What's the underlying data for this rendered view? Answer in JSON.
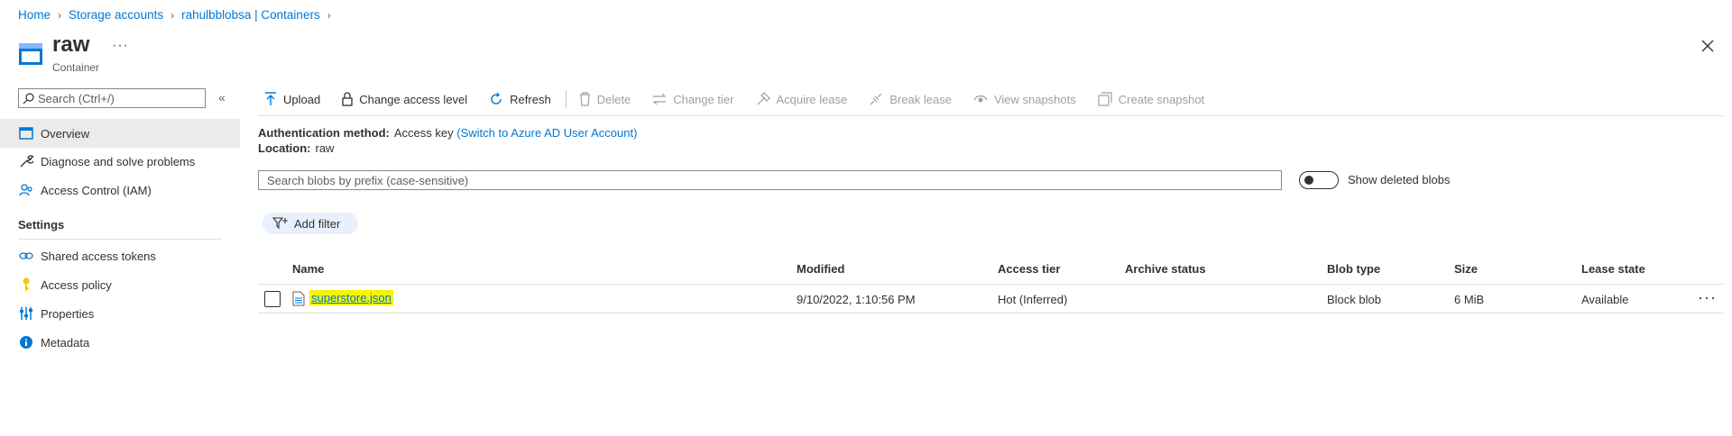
{
  "breadcrumb": [
    "Home",
    "Storage accounts",
    "rahulbblobsa | Containers"
  ],
  "header": {
    "title": "raw",
    "subtitle": "Container",
    "more": "···"
  },
  "nav": {
    "search_placeholder": "Search (Ctrl+/)",
    "collapse": "«",
    "items": [
      {
        "label": "Overview",
        "icon": "overview-icon",
        "selected": true
      },
      {
        "label": "Diagnose and solve problems",
        "icon": "wrench-icon"
      },
      {
        "label": "Access Control (IAM)",
        "icon": "people-icon"
      }
    ],
    "settings_heading": "Settings",
    "settings_items": [
      {
        "label": "Shared access tokens",
        "icon": "link-icon"
      },
      {
        "label": "Access policy",
        "icon": "key-icon"
      },
      {
        "label": "Properties",
        "icon": "sliders-icon"
      },
      {
        "label": "Metadata",
        "icon": "info-icon"
      }
    ]
  },
  "toolbar": {
    "upload": "Upload",
    "change_access": "Change access level",
    "refresh": "Refresh",
    "delete": "Delete",
    "change_tier": "Change tier",
    "acquire_lease": "Acquire lease",
    "break_lease": "Break lease",
    "view_snapshots": "View snapshots",
    "create_snapshot": "Create snapshot"
  },
  "info": {
    "auth_key": "Authentication method:",
    "auth_value": "Access key",
    "auth_link": "(Switch to Azure AD User Account)",
    "location_key": "Location:",
    "location_value": "raw"
  },
  "search": {
    "placeholder": "Search blobs by prefix (case-sensitive)",
    "toggle_label": "Show deleted blobs"
  },
  "filter": {
    "add_label": "Add filter"
  },
  "table": {
    "columns": [
      "Name",
      "Modified",
      "Access tier",
      "Archive status",
      "Blob type",
      "Size",
      "Lease state"
    ],
    "rows": [
      {
        "name": "superstore.json",
        "modified": "9/10/2022, 1:10:56 PM",
        "access_tier": "Hot (Inferred)",
        "archive_status": "",
        "blob_type": "Block blob",
        "size": "6 MiB",
        "lease_state": "Available"
      }
    ],
    "row_more": "···"
  },
  "colors": {
    "accent": "#0078d4",
    "highlight": "#f5f500",
    "selected_nav": "#edebe9"
  }
}
